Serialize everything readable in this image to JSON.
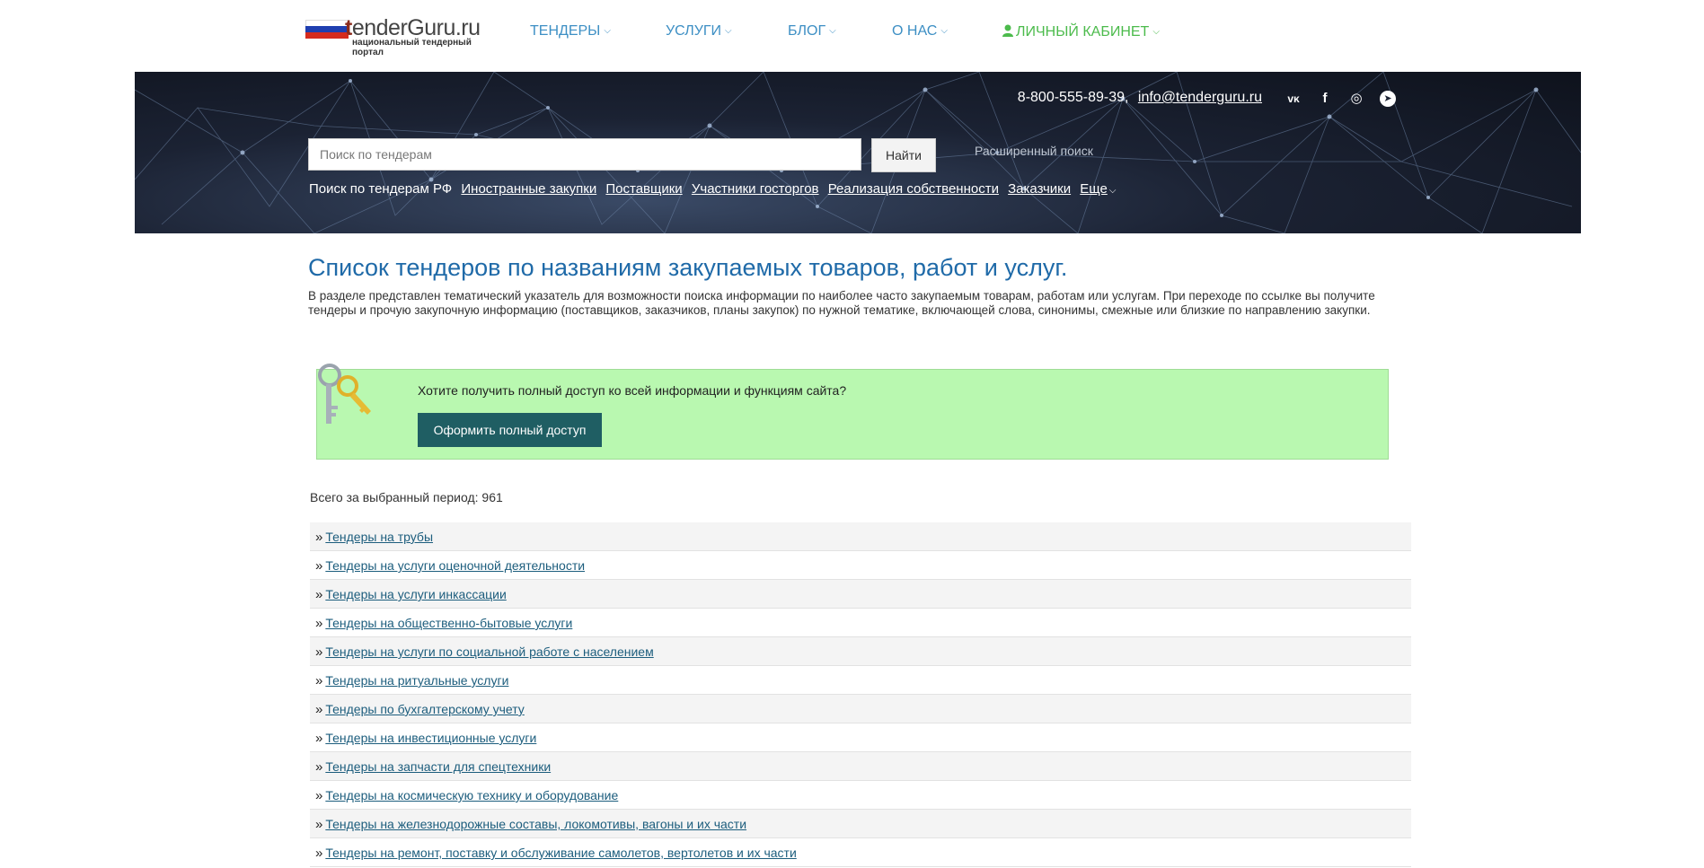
{
  "logo": {
    "brand_letter": "t",
    "brand_rest": "enderGuru.ru",
    "tagline": "национальный тендерный портал"
  },
  "nav": [
    {
      "label": "ТЕНДЕРЫ"
    },
    {
      "label": "УСЛУГИ"
    },
    {
      "label": "БЛОГ"
    },
    {
      "label": "О НАС"
    },
    {
      "label": "ЛИЧНЫЙ КАБИНЕТ"
    }
  ],
  "contacts": {
    "phone": "8-800-555-89-39,",
    "email": "info@tenderguru.ru"
  },
  "socials": [
    {
      "icon": "vk-icon",
      "glyph": "ᴠᴋ"
    },
    {
      "icon": "facebook-icon",
      "glyph": "f"
    },
    {
      "icon": "instagram-icon",
      "glyph": "◎"
    },
    {
      "icon": "telegram-icon",
      "glyph": "➤"
    }
  ],
  "search": {
    "placeholder": "Поиск по тендерам",
    "button": "Найти",
    "advanced": "Расширенный поиск"
  },
  "quicklinks": {
    "lead": "Поиск по тендерам РФ",
    "links": [
      "Иностранные закупки",
      "Поставщики",
      "Участники госторгов",
      "Реализация собственности",
      "Заказчики",
      "Еще"
    ]
  },
  "content": {
    "title": "Список тендеров по названиям закупаемых товаров, работ и услуг.",
    "intro": "В разделе представлен тематический указатель для возможности поиска информации по наиболее часто закупаемым товарам, работам или услугам. При переходе по ссылке вы получите тендеры и прочую закупочную информацию (поставщиков, заказчиков, планы закупок) по нужной тематике, включающей слова, синонимы, смежные или близкие по направлению закупки.",
    "promo_text": "Хотите получить полный доступ ко всей информации и функциям сайта?",
    "promo_button": "Оформить полный доступ",
    "total": "Всего за выбранный период: 961"
  },
  "tenders": [
    "Тендеры на трубы",
    "Тендеры на услуги оценочной деятельности",
    "Тендеры на услуги инкассации",
    "Тендеры на общественно-бытовые услуги",
    "Тендеры на услуги по социальной работе с населением",
    "Тендеры на ритуальные услуги",
    "Тендеры по бухгалтерскому учету",
    "Тендеры на инвестиционные услуги",
    "Тендеры на запчасти для спецтехники",
    "Тендеры на космическую технику и оборудование",
    "Тендеры на железнодорожные составы, локомотивы, вагоны и их части",
    "Тендеры на ремонт, поставку и обслуживание самолетов, вертолетов и их части"
  ],
  "colors": {
    "nav": "#3d8fc4",
    "account": "#4cbb4c",
    "title": "#1f6aa8",
    "promo_bg": "#b9f8b0",
    "promo_button": "#1f5e63",
    "link": "#1c5d7d"
  }
}
